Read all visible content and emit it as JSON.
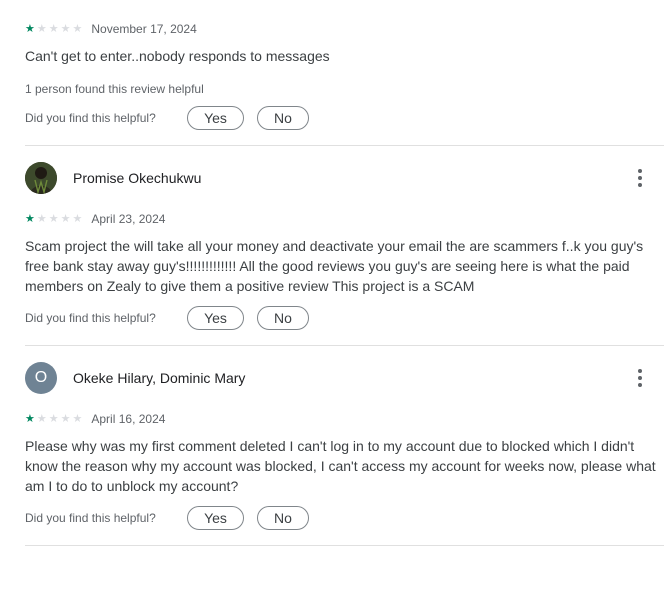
{
  "helpful_question": "Did you find this helpful?",
  "yes_label": "Yes",
  "no_label": "No",
  "star_glyph": "★",
  "reviews": [
    {
      "rating": 1,
      "date": "November 17, 2024",
      "text": "Can't get to enter..nobody responds to messages",
      "helpful_count": "1 person found this review helpful"
    },
    {
      "author": "Promise Okechukwu",
      "avatar": "photo",
      "rating": 1,
      "date": "April 23, 2024",
      "text": "Scam project the will take all your money and deactivate your email the are scammers f..k you guy's free bank stay away guy's!!!!!!!!!!!!! All the good reviews you guy's are seeing here is what the paid members on Zealy to give them a positive review This project is a SCAM"
    },
    {
      "author": "Okeke Hilary, Dominic Mary",
      "avatar_letter": "O",
      "avatar_color": "#6f8394",
      "rating": 1,
      "date": "April 16, 2024",
      "text": "Please why was my first comment deleted I can't log in to my account due to blocked which I didn't know the reason why my account was blocked, I can't access my account for weeks now, please what am I to do to unblock my account?"
    }
  ]
}
